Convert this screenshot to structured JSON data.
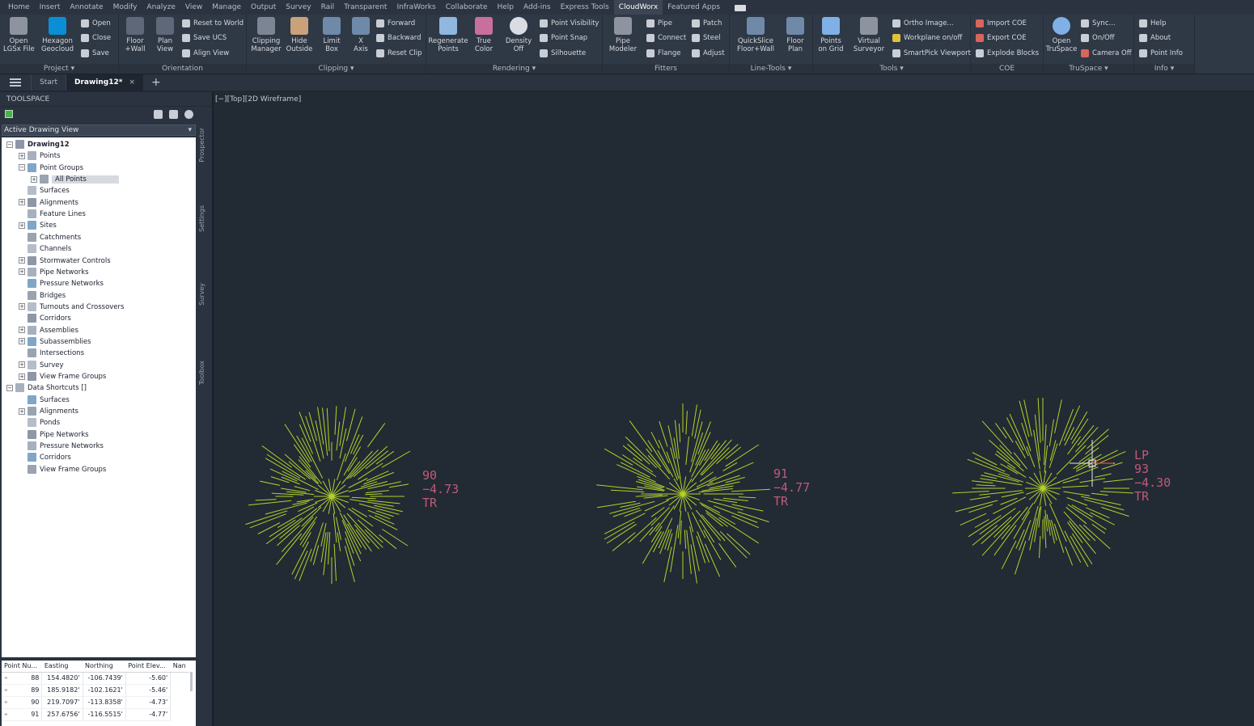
{
  "ribbon_tabs": [
    "Home",
    "Insert",
    "Annotate",
    "Modify",
    "Analyze",
    "View",
    "Manage",
    "Output",
    "Survey",
    "Rail",
    "Transparent",
    "InfraWorks",
    "Collaborate",
    "Help",
    "Add-ins",
    "Express Tools",
    "CloudWorx",
    "Featured Apps"
  ],
  "active_ribbon_tab": "CloudWorx",
  "panels": {
    "project": {
      "title": "Project",
      "open_lgsx": "Open\nLGSx File",
      "hexagon": "Hexagon\nGeocloud",
      "open": "Open",
      "close": "Close",
      "save": "Save"
    },
    "orientation": {
      "title": "Orientation",
      "floor_wall": "Floor\n+Wall",
      "plan_view": "Plan\nView",
      "reset_world": "Reset to World",
      "save_ucs": "Save UCS",
      "align_view": "Align View"
    },
    "clipping": {
      "title": "Clipping",
      "clipping_manager": "Clipping\nManager",
      "hide_outside": "Hide\nOutside",
      "limit_box": "Limit\nBox",
      "x_axis": "X\nAxis",
      "forward": "Forward",
      "backward": "Backward",
      "reset_clip": "Reset Clip"
    },
    "rendering": {
      "title": "Rendering",
      "regenerate": "Regenerate\nPoints",
      "true_color": "True\nColor",
      "density_off": "Density\nOff",
      "point_visibility": "Point Visibility",
      "point_snap": "Point Snap",
      "silhouette": "Silhouette"
    },
    "fitters": {
      "title": "Fitters",
      "pipe_modeler": "Pipe\nModeler",
      "pipe": "Pipe",
      "connect": "Connect",
      "flange": "Flange",
      "patch": "Patch",
      "steel": "Steel",
      "adjust": "Adjust"
    },
    "line_tools": {
      "title": "Line-Tools",
      "quickslice": "QuickSlice\nFloor+Wall",
      "floor_plan": "Floor\nPlan"
    },
    "tools": {
      "title": "Tools",
      "points_on_grid": "Points\non Grid",
      "virtual_surveyor": "Virtual\nSurveyor",
      "ortho_image": "Ortho Image...",
      "workplane": "Workplane on/off",
      "smartpick": "SmartPick Viewport"
    },
    "coe": {
      "title": "COE",
      "import_coe": "Import COE",
      "export_coe": "Export COE",
      "explode_blocks": "Explode Blocks"
    },
    "truspace": {
      "title": "TruSpace",
      "open_truspace": "Open\nTruSpace",
      "sync": "Sync...",
      "on_off": "On/Off",
      "camera_off": "Camera Off"
    },
    "info": {
      "title": "Info",
      "help": "Help",
      "about": "About",
      "point_info": "Point Info"
    }
  },
  "file_tabs": {
    "start": "Start",
    "drawing": "Drawing12*",
    "close_glyph": "×",
    "new_glyph": "+"
  },
  "toolspace": {
    "title": "TOOLSPACE",
    "view_selector": "Active Drawing View",
    "side_tabs": [
      "Prospector",
      "Settings",
      "Survey",
      "Toolbox"
    ],
    "tree": [
      {
        "label": "Drawing12",
        "level": 0,
        "exp": "−",
        "bold": true
      },
      {
        "label": "Points",
        "level": 1,
        "exp": "+"
      },
      {
        "label": "Point Groups",
        "level": 1,
        "exp": "−"
      },
      {
        "label": "All Points",
        "level": 2,
        "exp": "+",
        "selected": true
      },
      {
        "label": "Surfaces",
        "level": 1,
        "exp": ""
      },
      {
        "label": "Alignments",
        "level": 1,
        "exp": "+"
      },
      {
        "label": "Feature Lines",
        "level": 1,
        "exp": ""
      },
      {
        "label": "Sites",
        "level": 1,
        "exp": "+"
      },
      {
        "label": "Catchments",
        "level": 1,
        "exp": ""
      },
      {
        "label": "Channels",
        "level": 1,
        "exp": ""
      },
      {
        "label": "Stormwater Controls",
        "level": 1,
        "exp": "+"
      },
      {
        "label": "Pipe Networks",
        "level": 1,
        "exp": "+"
      },
      {
        "label": "Pressure Networks",
        "level": 1,
        "exp": ""
      },
      {
        "label": "Bridges",
        "level": 1,
        "exp": ""
      },
      {
        "label": "Turnouts and Crossovers",
        "level": 1,
        "exp": "+"
      },
      {
        "label": "Corridors",
        "level": 1,
        "exp": ""
      },
      {
        "label": "Assemblies",
        "level": 1,
        "exp": "+"
      },
      {
        "label": "Subassemblies",
        "level": 1,
        "exp": "+"
      },
      {
        "label": "Intersections",
        "level": 1,
        "exp": ""
      },
      {
        "label": "Survey",
        "level": 1,
        "exp": "+"
      },
      {
        "label": "View Frame Groups",
        "level": 1,
        "exp": "+"
      },
      {
        "label": "Data Shortcuts []",
        "level": 0,
        "exp": "−"
      },
      {
        "label": "Surfaces",
        "level": 1,
        "exp": ""
      },
      {
        "label": "Alignments",
        "level": 1,
        "exp": "+"
      },
      {
        "label": "Ponds",
        "level": 1,
        "exp": ""
      },
      {
        "label": "Pipe Networks",
        "level": 1,
        "exp": ""
      },
      {
        "label": "Pressure Networks",
        "level": 1,
        "exp": ""
      },
      {
        "label": "Corridors",
        "level": 1,
        "exp": ""
      },
      {
        "label": "View Frame Groups",
        "level": 1,
        "exp": ""
      }
    ]
  },
  "points_table": {
    "columns": [
      "Point Nu...",
      "Easting",
      "Northing",
      "Point Elev...",
      "Nan"
    ],
    "rows": [
      [
        "88",
        "154.4820'",
        "-106.7439'",
        "-5.60'"
      ],
      [
        "89",
        "185.9182'",
        "-102.1621'",
        "-5.46'"
      ],
      [
        "90",
        "219.7097'",
        "-113.8358'",
        "-4.73'"
      ],
      [
        "91",
        "257.6756'",
        "-116.5515'",
        "-4.77'"
      ]
    ]
  },
  "viewport": {
    "label": "[−][Top][2D Wireframe]",
    "point_color": "#b5d12a",
    "label_color": "#c05a78",
    "points": [
      {
        "number": "90",
        "elevation": "−4.73",
        "code": "TR"
      },
      {
        "number": "91",
        "elevation": "−4.77",
        "code": "TR"
      },
      {
        "prefix": "LP",
        "number": "93",
        "elevation": "−4.30",
        "code": "TR"
      }
    ]
  }
}
